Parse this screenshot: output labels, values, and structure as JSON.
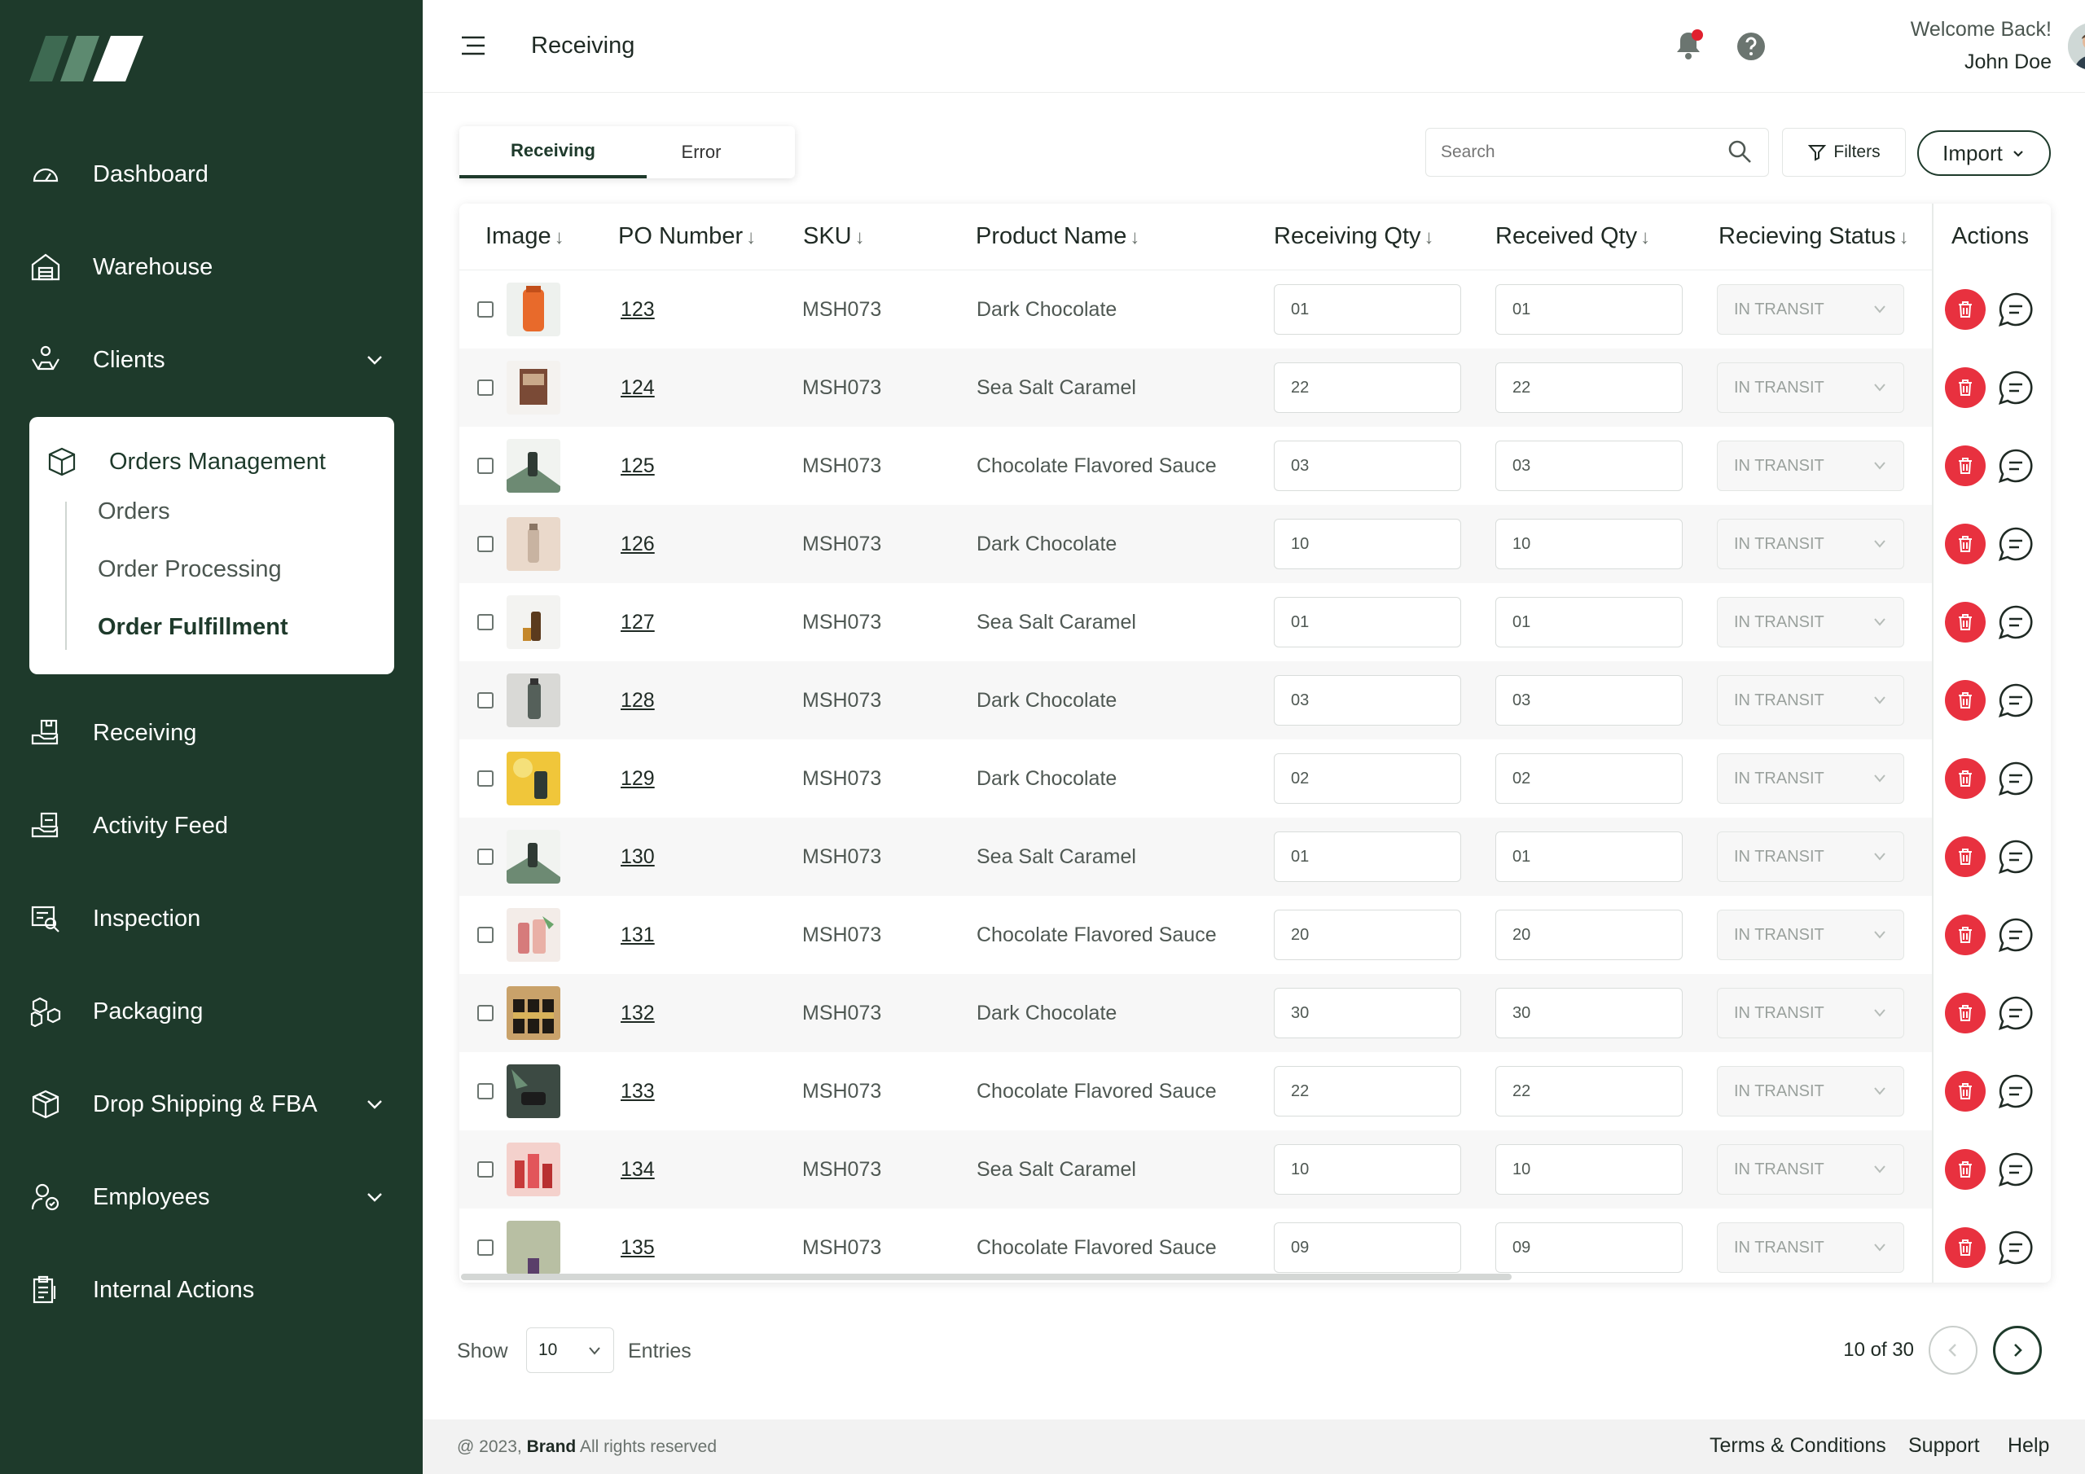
{
  "sidebar": {
    "items": [
      {
        "label": "Dashboard",
        "icon": "dashboard-gauge-icon"
      },
      {
        "label": "Warehouse",
        "icon": "warehouse-icon"
      },
      {
        "label": "Clients",
        "icon": "clients-handshake-icon",
        "expandable": true
      },
      {
        "label": "Orders Management",
        "icon": "orders-box-icon",
        "expanded": true,
        "children": [
          {
            "label": "Orders"
          },
          {
            "label": "Order Processing"
          },
          {
            "label": "Order Fulfillment",
            "active": true
          }
        ]
      },
      {
        "label": "Receiving",
        "icon": "receiving-icon"
      },
      {
        "label": "Activity Feed",
        "icon": "activity-feed-icon"
      },
      {
        "label": "Inspection",
        "icon": "inspection-icon"
      },
      {
        "label": "Packaging",
        "icon": "packaging-icon"
      },
      {
        "label": "Drop Shipping & FBA",
        "icon": "drop-shipping-icon",
        "expandable": true
      },
      {
        "label": "Employees",
        "icon": "employees-icon",
        "expandable": true
      },
      {
        "label": "Internal Actions",
        "icon": "internal-actions-icon"
      }
    ]
  },
  "header": {
    "title": "Receiving",
    "welcome": "Welcome Back!",
    "user_name": "John Doe"
  },
  "tabs": [
    {
      "label": "Receiving",
      "active": true
    },
    {
      "label": "Error",
      "active": false
    }
  ],
  "toolbar": {
    "search_placeholder": "Search",
    "filters_label": "Filters",
    "import_label": "Import"
  },
  "table": {
    "columns": [
      "Image",
      "PO Number",
      "SKU",
      "Product Name",
      "Receiving Qty",
      "Received Qty",
      "Recieving Status",
      "Actions"
    ],
    "rows": [
      {
        "po": "123",
        "sku": "MSH073",
        "product": "Dark Chocolate",
        "receiving_qty": "01",
        "received_qty": "01",
        "status": "IN TRANSIT"
      },
      {
        "po": "124",
        "sku": "MSH073",
        "product": "Sea Salt Caramel",
        "receiving_qty": "22",
        "received_qty": "22",
        "status": "IN TRANSIT"
      },
      {
        "po": "125",
        "sku": "MSH073",
        "product": "Chocolate Flavored Sauce",
        "receiving_qty": "03",
        "received_qty": "03",
        "status": "IN TRANSIT"
      },
      {
        "po": "126",
        "sku": "MSH073",
        "product": "Dark Chocolate",
        "receiving_qty": "10",
        "received_qty": "10",
        "status": "IN TRANSIT"
      },
      {
        "po": "127",
        "sku": "MSH073",
        "product": "Sea Salt Caramel",
        "receiving_qty": "01",
        "received_qty": "01",
        "status": "IN TRANSIT"
      },
      {
        "po": "128",
        "sku": "MSH073",
        "product": "Dark Chocolate",
        "receiving_qty": "03",
        "received_qty": "03",
        "status": "IN TRANSIT"
      },
      {
        "po": "129",
        "sku": "MSH073",
        "product": "Dark Chocolate",
        "receiving_qty": "02",
        "received_qty": "02",
        "status": "IN TRANSIT"
      },
      {
        "po": "130",
        "sku": "MSH073",
        "product": "Sea Salt Caramel",
        "receiving_qty": "01",
        "received_qty": "01",
        "status": "IN TRANSIT"
      },
      {
        "po": "131",
        "sku": "MSH073",
        "product": "Chocolate Flavored Sauce",
        "receiving_qty": "20",
        "received_qty": "20",
        "status": "IN TRANSIT"
      },
      {
        "po": "132",
        "sku": "MSH073",
        "product": "Dark Chocolate",
        "receiving_qty": "30",
        "received_qty": "30",
        "status": "IN TRANSIT"
      },
      {
        "po": "133",
        "sku": "MSH073",
        "product": "Chocolate Flavored Sauce",
        "receiving_qty": "22",
        "received_qty": "22",
        "status": "IN TRANSIT"
      },
      {
        "po": "134",
        "sku": "MSH073",
        "product": "Sea Salt Caramel",
        "receiving_qty": "10",
        "received_qty": "10",
        "status": "IN TRANSIT"
      },
      {
        "po": "135",
        "sku": "MSH073",
        "product": "Chocolate Flavored Sauce",
        "receiving_qty": "09",
        "received_qty": "09",
        "status": "IN TRANSIT"
      }
    ]
  },
  "pagination": {
    "show_label": "Show",
    "page_size": "10",
    "entries_label": "Entries",
    "page_info": "10 of 30"
  },
  "footer": {
    "copyright_prefix": "@ 2023,",
    "brand": "Brand",
    "copyright_suffix": "All rights reserved",
    "links": [
      "Terms & Conditions",
      "Support",
      "Help"
    ]
  },
  "colors": {
    "sidebar_bg": "#1e3a2b",
    "accent": "#1e3a2b",
    "danger": "#e8313f",
    "notification_dot": "#e0202e"
  }
}
